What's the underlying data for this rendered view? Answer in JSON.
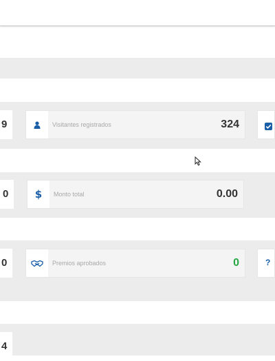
{
  "cards": {
    "visitors": {
      "label": "Visitantes registrados",
      "value": "324",
      "icon": "user-icon"
    },
    "amount": {
      "label": "Monto total",
      "value": "0.00",
      "icon": "dollar-icon"
    },
    "prizes": {
      "label": "Premios aprobados",
      "value": "0",
      "icon": "handshake-icon"
    }
  },
  "left_partial_values": [
    "9",
    "0",
    "0",
    "4"
  ],
  "right_partial_icons": [
    "checkbox-icon",
    "question-icon"
  ],
  "colors": {
    "accent": "#1a5ea8",
    "success": "#27a844",
    "band": "#ececec",
    "card": "#f4f4f4"
  }
}
